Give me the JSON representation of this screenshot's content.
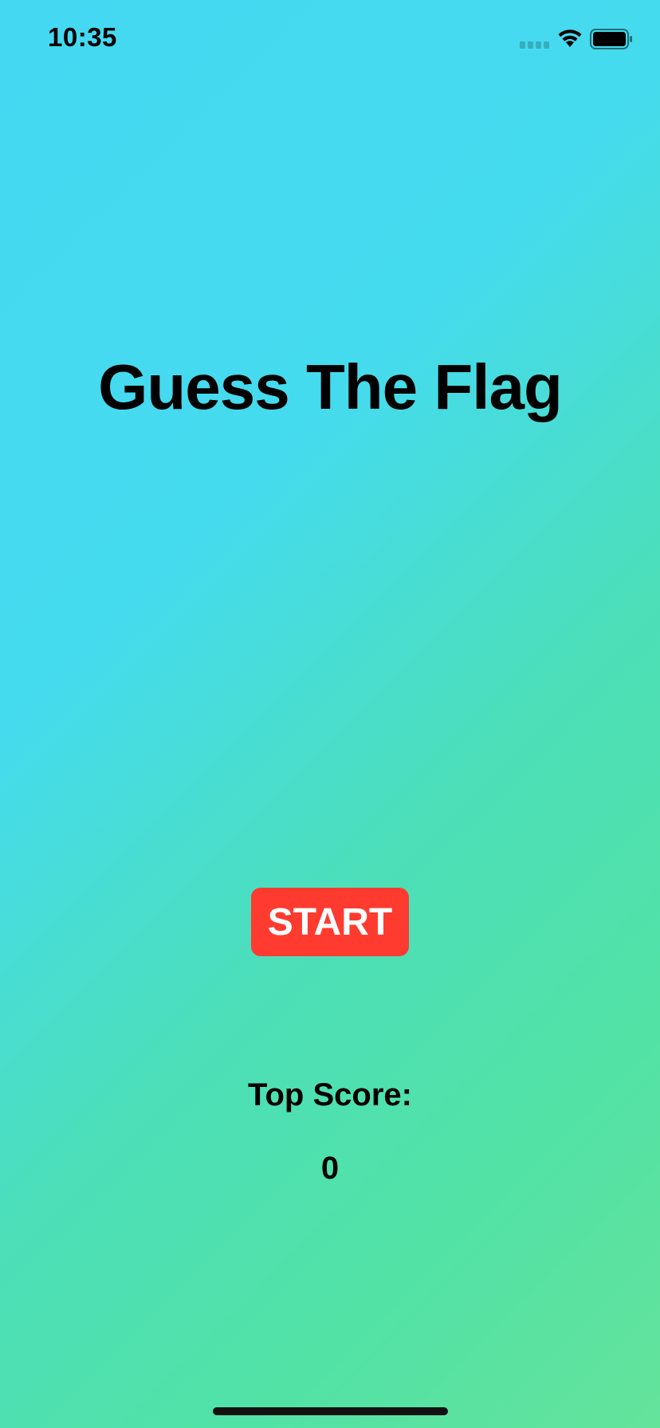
{
  "status_bar": {
    "time": "10:35",
    "signal_icon": "cellular-signal-icon",
    "wifi_icon": "wifi-icon",
    "battery_icon": "battery-icon"
  },
  "main": {
    "title": "Guess The Flag",
    "start_label": "START",
    "top_score_label": "Top Score:",
    "top_score_value": "0"
  },
  "colors": {
    "gradient_start": "#45d8f2",
    "gradient_end": "#64e39b",
    "start_button": "#ff3b30",
    "start_button_text": "#ffffff"
  }
}
